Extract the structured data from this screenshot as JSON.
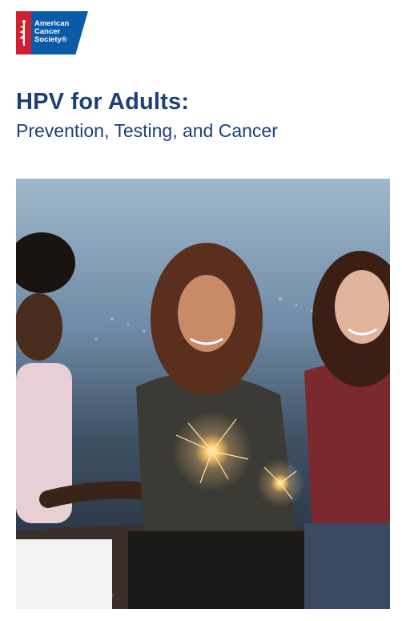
{
  "logo": {
    "line1": "American",
    "line2": "Cancer",
    "line3": "Society®",
    "colors": {
      "red": "#d1202f",
      "blue": "#0b5aa8"
    }
  },
  "heading": {
    "title": "HPV for Adults:",
    "subtitle": "Prevention, Testing, and Cancer"
  },
  "colors": {
    "heading": "#1d3f7a"
  }
}
